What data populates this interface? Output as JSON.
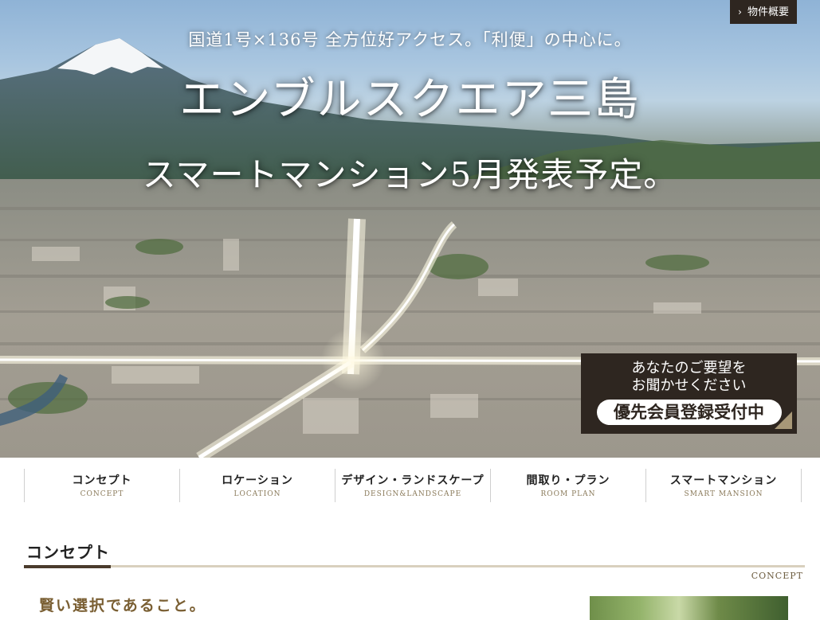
{
  "hero": {
    "tagline": "国道1号×136号 全方位好アクセス。「利便」の中心に。",
    "brand": "エンブルスクエア三島",
    "announce": "スマートマンション5月発表予定。",
    "overview_button": "物件概要",
    "register": {
      "line1": "あなたのご要望を",
      "line2": "お聞かせください",
      "cta": "優先会員登録受付中"
    }
  },
  "nav": [
    {
      "jp": "コンセプト",
      "en": "CONCEPT"
    },
    {
      "jp": "ロケーション",
      "en": "LOCATION"
    },
    {
      "jp": "デザイン・ランドスケープ",
      "en": "DESIGN&LANDSCAPE"
    },
    {
      "jp": "間取り・プラン",
      "en": "ROOM PLAN"
    },
    {
      "jp": "スマートマンション",
      "en": "SMART MANSION"
    }
  ],
  "concept": {
    "title": "コンセプト",
    "title_en": "CONCEPT",
    "lead": "賢い選択であること。"
  },
  "colors": {
    "dark_brown": "#2e2620",
    "accent_gold": "#8a7a5a",
    "lead_text": "#7a5f33"
  },
  "icons": {
    "overview": "chevron-right-icon",
    "register_corner": "corner-triangle-icon"
  }
}
